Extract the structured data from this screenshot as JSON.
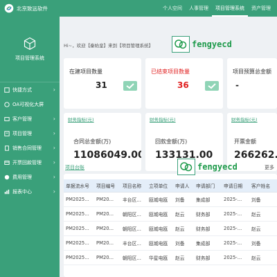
{
  "app": {
    "name": "北京致远软件"
  },
  "topnav": [
    {
      "label": "个人空间",
      "active": false
    },
    {
      "label": "人事管理",
      "active": false
    },
    {
      "label": "项目管理系统",
      "active": true
    },
    {
      "label": "资产管理",
      "active": false
    }
  ],
  "sidebar": {
    "title": "项目管理系统",
    "items": [
      {
        "label": "快捷方式",
        "icon": "shortcut-icon"
      },
      {
        "label": "OA可视化大屏",
        "icon": "dashboard-icon"
      },
      {
        "label": "客户管理",
        "icon": "customer-icon"
      },
      {
        "label": "项目管理",
        "icon": "project-icon"
      },
      {
        "label": "销售合同管理",
        "icon": "contract-icon"
      },
      {
        "label": "开票回款管理",
        "icon": "invoice-icon"
      },
      {
        "label": "费用管理",
        "icon": "expense-icon"
      },
      {
        "label": "报表中心",
        "icon": "report-icon"
      }
    ]
  },
  "welcome": "Hi~，欢迎【秦始皇】来到【项目管理系统】",
  "stats": [
    {
      "label": "在建项目数量",
      "value": "31"
    },
    {
      "label": "已结束项目数量",
      "value": "36",
      "color": "#e02020"
    },
    {
      "label": "项目预算总金额",
      "value": "-"
    }
  ],
  "finance": [
    {
      "link": "财务指标(元)",
      "label": "合同总金额(万)",
      "value": "11086049.00"
    },
    {
      "link": "财务指标(元)",
      "label": "回款金额(万)",
      "value": "133131.00"
    },
    {
      "link": "财务指标(元)",
      "label": "开票金额",
      "value": "266262.00"
    }
  ],
  "table": {
    "title": "项目台账",
    "more": "更多",
    "columns": [
      "单据流水号",
      "项目编号",
      "项目名称",
      "立项单位",
      "申请人",
      "申请部门",
      "申请日期",
      "客户姓名"
    ],
    "rows": [
      [
        "PM2025...",
        "PM20...",
        "丰台区...",
        "瓯城电瓯",
        "刘备",
        "集成部",
        "2025-...",
        "刘备"
      ],
      [
        "PM2025...",
        "PM20...",
        "朝阳区...",
        "瓯城电瓯",
        "赵云",
        "财务部",
        "2025-...",
        "赵云"
      ],
      [
        "PM2025...",
        "PM20...",
        "朝阳区...",
        "瓯城电瓯",
        "赵云",
        "财务部",
        "2025-...",
        "赵云"
      ],
      [
        "PM2025...",
        "PM20...",
        "丰台区...",
        "瓯城电瓯",
        "刘备",
        "集成部",
        "2025-...",
        "刘备"
      ],
      [
        "PM2025...",
        "PM20...",
        "朝阳区...",
        "华星电瓯",
        "赵云",
        "财务部",
        "2025-...",
        "赵云"
      ]
    ]
  },
  "watermark": "fengyecd",
  "colors": {
    "brand": "#3aa07a",
    "danger": "#e02020",
    "link": "#3aa07a"
  }
}
